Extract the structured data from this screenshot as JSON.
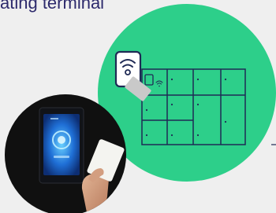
{
  "heading": "ating terminal",
  "colors": {
    "background": "#efefef",
    "heading_text": "#2d2a6c",
    "locker_circle": "#2dcf8a",
    "locker_lines": "#1f2a55",
    "photo_circle": "#0a0a0a",
    "terminal_screen": "#1f6fd6",
    "card": "#f4f4f0",
    "hand_skin": "#d9a787"
  },
  "icons": {
    "reader": "contactless-reader-icon",
    "wifi": "wifi-icon",
    "card": "card-icon"
  }
}
